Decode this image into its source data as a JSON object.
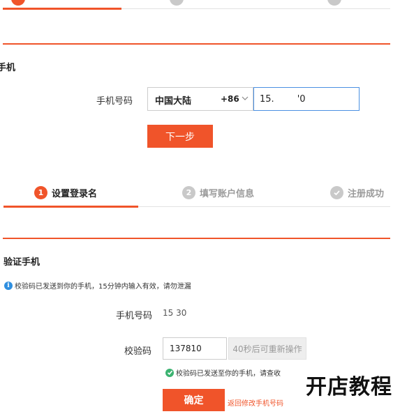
{
  "top_section": {
    "title_partial": "手机",
    "phone_label": "手机号码",
    "region": "中国大陆",
    "country_code": "+86",
    "phone_value": "15.        '0",
    "next_button": "下一步"
  },
  "steps": [
    {
      "number": "1",
      "label": "设置登录名",
      "state": "active"
    },
    {
      "number": "2",
      "label": "填写账户信息",
      "state": "pending"
    },
    {
      "number": "",
      "label": "注册成功",
      "state": "pending",
      "icon": "check-circle-icon"
    }
  ],
  "verify_section": {
    "title": "验证手机",
    "notice": "校验码已发送到你的手机，15分钟内输入有效，请勿泄漏",
    "phone_label": "手机号码",
    "phone_masked": "15            30",
    "code_label": "校验码",
    "code_value": "137810",
    "resend_label": "40秒后可重新操作",
    "sent_tip": "校验码已发送至你的手机，请查收",
    "confirm_button": "确定",
    "back_link": "返回修改手机号码"
  },
  "watermark": "开店教程",
  "colors": {
    "accent": "#f0542a",
    "input_focus": "#4a90e2",
    "info_blue": "#2f8fe0",
    "success_green": "#3cb371"
  }
}
